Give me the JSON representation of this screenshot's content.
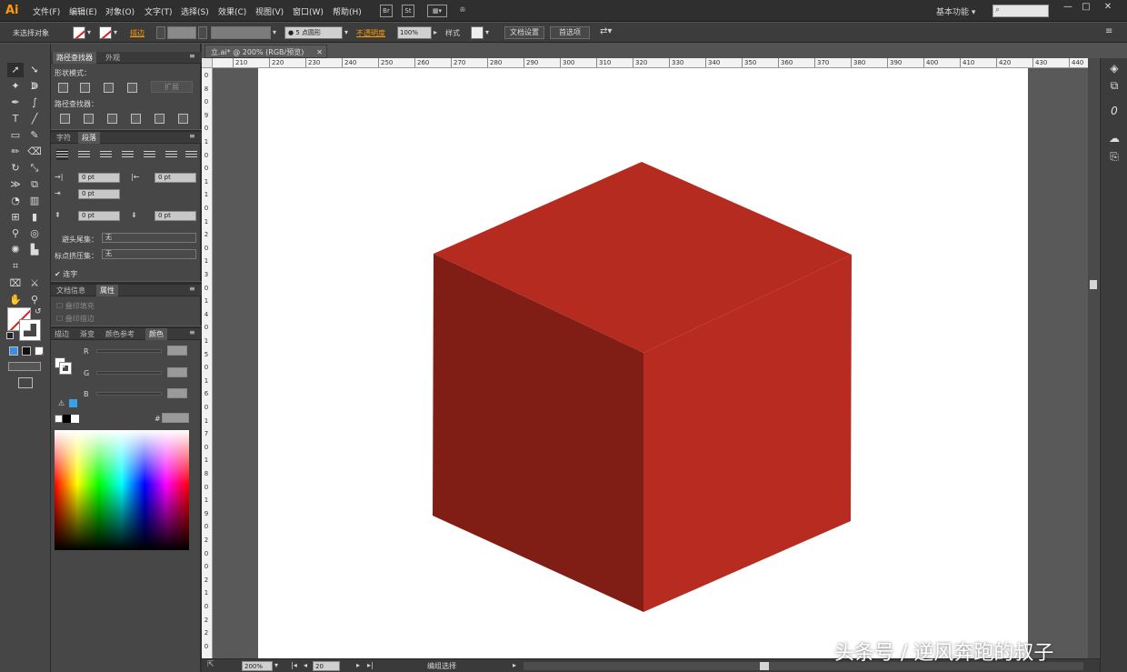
{
  "app": {
    "logo": "Ai",
    "workspace": "基本功能"
  },
  "menu": [
    "文件(F)",
    "编辑(E)",
    "对象(O)",
    "文字(T)",
    "选择(S)",
    "效果(C)",
    "视图(V)",
    "窗口(W)",
    "帮助(H)"
  ],
  "menubar_icons": {
    "bridge": "Br",
    "stock": "St"
  },
  "window_controls": {
    "minimize": "—",
    "maximize": "□",
    "close": "✕"
  },
  "control_bar": {
    "selection": "未选择对象",
    "stroke_label": "描边",
    "brush_value": "● 5 点圆形",
    "opacity_label": "不透明度",
    "opacity_value": "100%",
    "style_label": "样式",
    "doc_setup_button": "文档设置",
    "prefs_button": "首选项"
  },
  "document": {
    "tab_title": "立.ai* @ 200% (RGB/预览)",
    "close": "✕"
  },
  "ruler": {
    "h_ticks": [
      "210",
      "220",
      "230",
      "240",
      "250",
      "260",
      "270",
      "280",
      "290",
      "300",
      "310",
      "320",
      "330",
      "340",
      "350",
      "360",
      "370",
      "380",
      "390",
      "400",
      "410",
      "420",
      "430",
      "440"
    ],
    "v_ticks": [
      "0",
      "8",
      "0",
      "9",
      "0",
      "1",
      "0",
      "0",
      "1",
      "1",
      "0",
      "1",
      "2",
      "0",
      "1",
      "3",
      "0",
      "1",
      "4",
      "0",
      "1",
      "5",
      "0",
      "1",
      "6",
      "0",
      "1",
      "7",
      "0",
      "1",
      "8",
      "0",
      "1",
      "9",
      "0",
      "2",
      "0",
      "0",
      "2",
      "1",
      "0",
      "2",
      "2",
      "0"
    ]
  },
  "panels": {
    "pathfinder": {
      "tabs": [
        "路径查找器",
        "外观"
      ],
      "shape_modes_label": "形状模式：",
      "expand_button": "扩展",
      "pathfinders_label": "路径查找器："
    },
    "paragraph": {
      "tabs": [
        "字符",
        "段落"
      ],
      "indent_left": "0 pt",
      "indent_right": "0 pt",
      "first_line": "0 pt",
      "space_before": "0 pt",
      "space_after": "0 pt",
      "avoid_break_label": "避头尾集：",
      "avoid_break_value": "无",
      "punct_label": "标点挤压集：",
      "punct_value": "无",
      "hyphenation_label": "连字"
    },
    "attributes": {
      "tabs": [
        "文档信息",
        "属性"
      ],
      "overprint_fill": "叠印填充",
      "overprint_stroke": "叠印描边"
    },
    "color": {
      "tabs": [
        "描边",
        "渐变",
        "颜色参考",
        "颜色"
      ],
      "channels": [
        "R",
        "G",
        "B"
      ],
      "hex_label": "#"
    }
  },
  "status": {
    "zoom": "200%",
    "page": "20",
    "mode": "编组选择"
  },
  "watermark": "头条号 / 逆风奔跑的叔子",
  "colors": {
    "cube_top": "#b62b20",
    "cube_left": "#801e16",
    "cube_right": "#b82b20",
    "accent": "#ff9a00"
  }
}
